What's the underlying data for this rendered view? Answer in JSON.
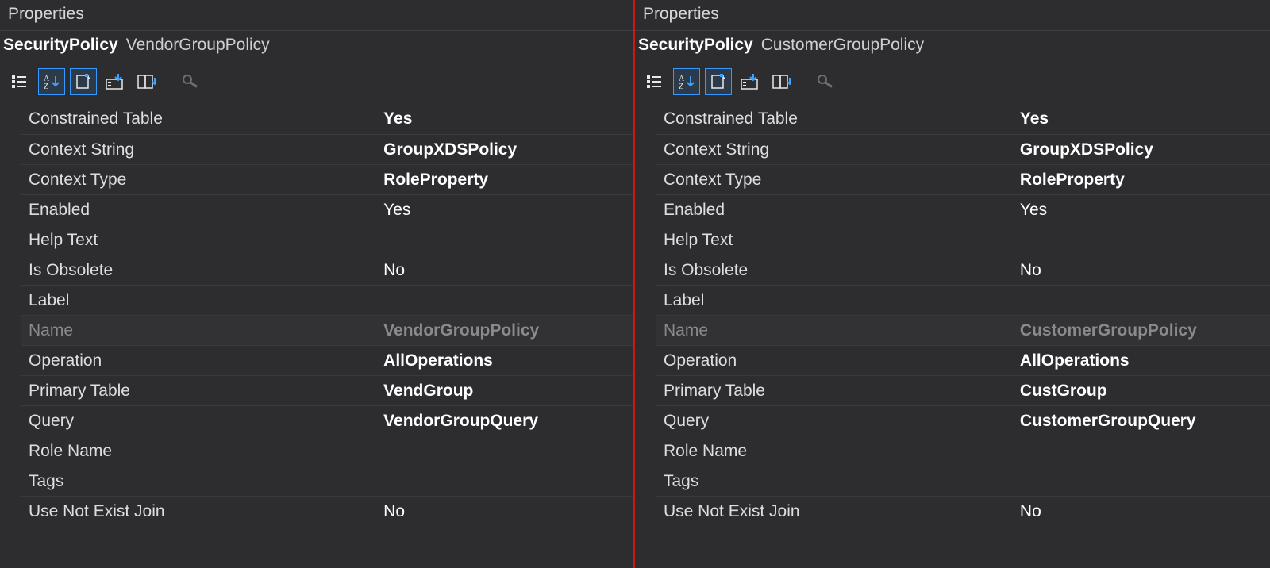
{
  "left": {
    "panel_title": "Properties",
    "object_type": "SecurityPolicy",
    "object_name": "VendorGroupPolicy",
    "rows": [
      {
        "label": "Constrained Table",
        "value": "Yes",
        "bold": true
      },
      {
        "label": "Context String",
        "value": "GroupXDSPolicy",
        "bold": true
      },
      {
        "label": "Context Type",
        "value": "RoleProperty",
        "bold": true
      },
      {
        "label": "Enabled",
        "value": "Yes",
        "bold": false
      },
      {
        "label": "Help Text",
        "value": "",
        "bold": false
      },
      {
        "label": "Is Obsolete",
        "value": "No",
        "bold": false
      },
      {
        "label": "Label",
        "value": "",
        "bold": false
      },
      {
        "label": "Name",
        "value": "VendorGroupPolicy",
        "bold": false,
        "dim": true
      },
      {
        "label": "Operation",
        "value": "AllOperations",
        "bold": true
      },
      {
        "label": "Primary Table",
        "value": "VendGroup",
        "bold": true
      },
      {
        "label": "Query",
        "value": "VendorGroupQuery",
        "bold": true
      },
      {
        "label": "Role Name",
        "value": "",
        "bold": false
      },
      {
        "label": "Tags",
        "value": "",
        "bold": false
      },
      {
        "label": "Use Not Exist Join",
        "value": "No",
        "bold": false
      }
    ]
  },
  "right": {
    "panel_title": "Properties",
    "object_type": "SecurityPolicy",
    "object_name": "CustomerGroupPolicy",
    "rows": [
      {
        "label": "Constrained Table",
        "value": "Yes",
        "bold": true
      },
      {
        "label": "Context String",
        "value": "GroupXDSPolicy",
        "bold": true
      },
      {
        "label": "Context Type",
        "value": "RoleProperty",
        "bold": true
      },
      {
        "label": "Enabled",
        "value": "Yes",
        "bold": false
      },
      {
        "label": "Help Text",
        "value": "",
        "bold": false
      },
      {
        "label": "Is Obsolete",
        "value": "No",
        "bold": false
      },
      {
        "label": "Label",
        "value": "",
        "bold": false
      },
      {
        "label": "Name",
        "value": "CustomerGroupPolicy",
        "bold": false,
        "dim": true
      },
      {
        "label": "Operation",
        "value": "AllOperations",
        "bold": true
      },
      {
        "label": "Primary Table",
        "value": "CustGroup",
        "bold": true
      },
      {
        "label": "Query",
        "value": "CustomerGroupQuery",
        "bold": true
      },
      {
        "label": "Role Name",
        "value": "",
        "bold": false
      },
      {
        "label": "Tags",
        "value": "",
        "bold": false
      },
      {
        "label": "Use Not Exist Join",
        "value": "No",
        "bold": false
      }
    ]
  }
}
